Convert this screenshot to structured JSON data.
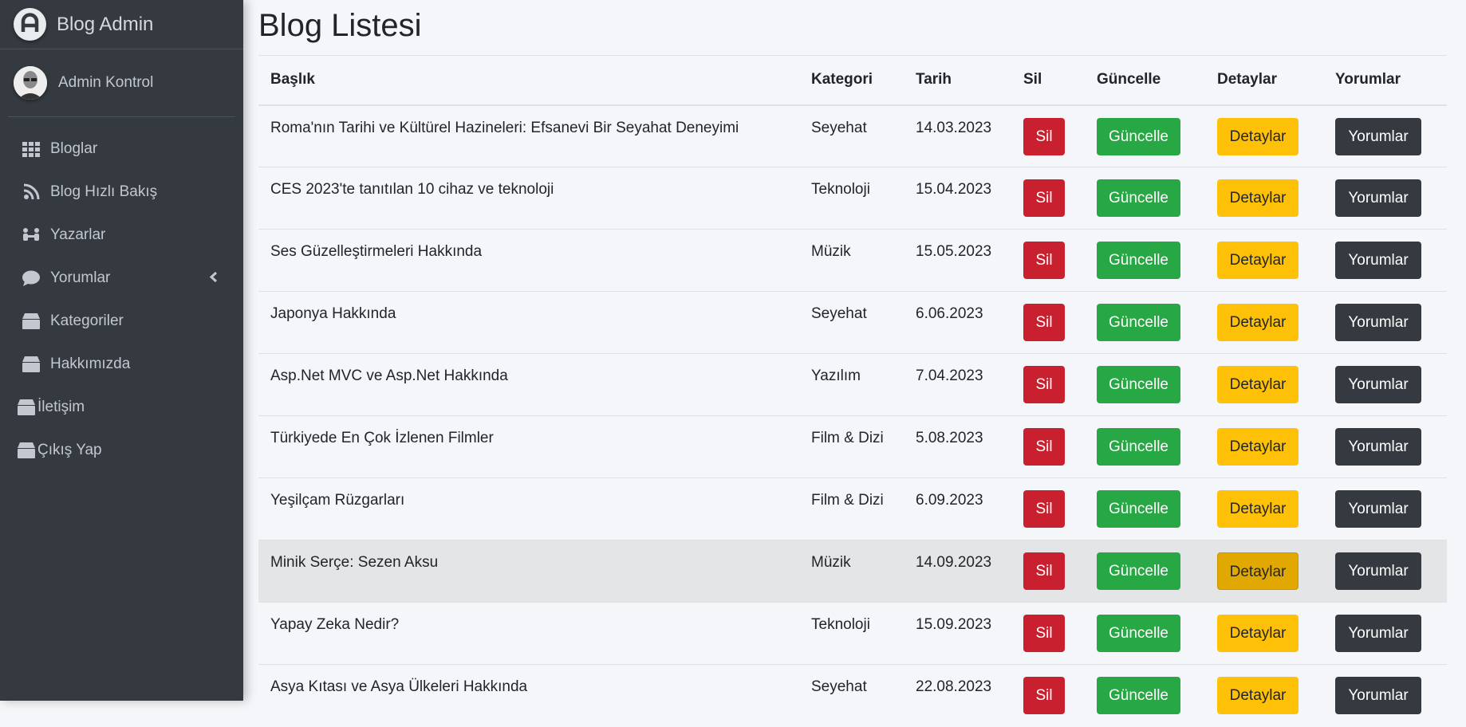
{
  "brand": {
    "title": "Blog Admin",
    "logo_icon": "adminlte-logo-icon"
  },
  "user": {
    "name": "Admin Kontrol",
    "avatar_icon": "user-avatar"
  },
  "sidebar": {
    "items": [
      {
        "label": "Bloglar",
        "icon": "grid-icon"
      },
      {
        "label": "Blog Hızlı Bakış",
        "icon": "blog-icon"
      },
      {
        "label": "Yazarlar",
        "icon": "users-icon"
      },
      {
        "label": "Yorumlar",
        "icon": "comment-icon"
      },
      {
        "label": "Kategoriler",
        "icon": "box-icon"
      },
      {
        "label": "Hakkımızda",
        "icon": "box-icon"
      },
      {
        "label": "İletişim",
        "icon": "box-icon"
      },
      {
        "label": "Çıkış Yap",
        "icon": "box-icon"
      }
    ]
  },
  "page": {
    "title": "Blog Listesi"
  },
  "table": {
    "headers": [
      "Başlık",
      "Kategori",
      "Tarih",
      "Sil",
      "Güncelle",
      "Detaylar",
      "Yorumlar"
    ],
    "buttons": {
      "sil": "Sil",
      "guncelle": "Güncelle",
      "detaylar": "Detaylar",
      "yorumlar": "Yorumlar"
    },
    "rows": [
      {
        "title": "Roma'nın Tarihi ve Kültürel Hazineleri: Efsanevi Bir Seyahat Deneyimi",
        "category": "Seyehat",
        "date": "14.03.2023"
      },
      {
        "title": "CES 2023'te tanıtılan 10 cihaz ve teknoloji",
        "category": "Teknoloji",
        "date": "15.04.2023"
      },
      {
        "title": "Ses Güzelleştirmeleri Hakkında",
        "category": "Müzik",
        "date": "15.05.2023"
      },
      {
        "title": "Japonya Hakkında",
        "category": "Seyehat",
        "date": "6.06.2023"
      },
      {
        "title": "Asp.Net MVC ve Asp.Net Hakkında",
        "category": "Yazılım",
        "date": "7.04.2023"
      },
      {
        "title": "Türkiyede En Çok İzlenen Filmler",
        "category": "Film & Dizi",
        "date": "5.08.2023"
      },
      {
        "title": "Yeşilçam Rüzgarları",
        "category": "Film & Dizi",
        "date": "6.09.2023"
      },
      {
        "title": "Minik Serçe: Sezen Aksu",
        "category": "Müzik",
        "date": "14.09.2023"
      },
      {
        "title": "Yapay Zeka Nedir?",
        "category": "Teknoloji",
        "date": "15.09.2023"
      },
      {
        "title": "Asya Kıtası ve Asya Ülkeleri Hakkında",
        "category": "Seyehat",
        "date": "22.08.2023"
      }
    ]
  },
  "colors": {
    "sidebar_bg": "#343a40",
    "danger": "#c8202f",
    "success": "#28a745",
    "warning": "#ffc107",
    "dark": "#343a40"
  }
}
